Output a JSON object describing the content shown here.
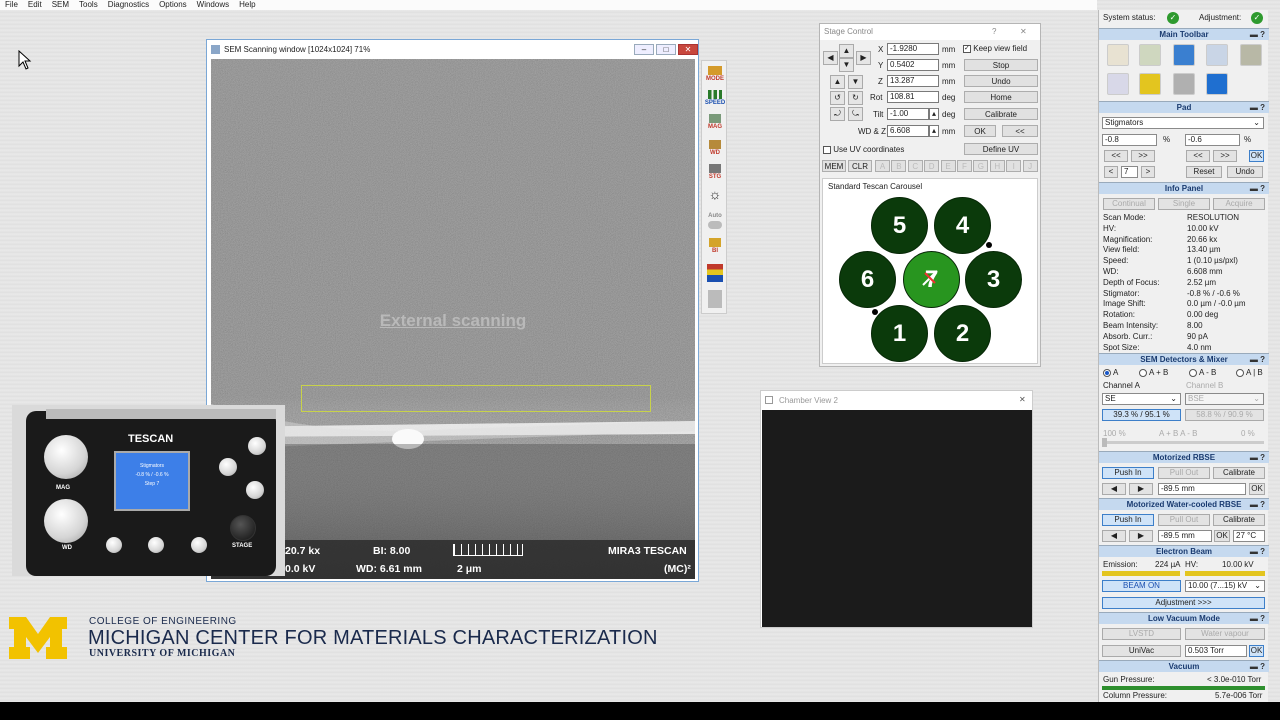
{
  "menu": [
    "File",
    "Edit",
    "SEM",
    "Tools",
    "Diagnostics",
    "Options",
    "Windows",
    "Help"
  ],
  "sem_window": {
    "title": "SEM Scanning window [1024x1024] 71%",
    "overlay_text": "External scanning",
    "info": {
      "mag": "20.7 kx",
      "hv": "0.0 kV",
      "bi": "BI: 8.00",
      "wd": "WD: 6.61 mm",
      "scale": "2 μm",
      "model": "MIRA3 TESCAN",
      "lab": "(MC)²"
    }
  },
  "side_toolbar": [
    "MODE",
    "SPEED",
    "MAG",
    "WD",
    "STG",
    "",
    "Auto",
    "BI",
    "",
    ""
  ],
  "stage": {
    "title": "Stage Control",
    "help": "?",
    "close": "✕",
    "x_label": "X",
    "x_value": "-1.9280",
    "x_unit": "mm",
    "y_label": "Y",
    "y_value": "0.5402",
    "y_unit": "mm",
    "z_label": "Z",
    "z_value": "13.287",
    "z_unit": "mm",
    "rot_label": "Rot",
    "rot_value": "108.81",
    "rot_unit": "deg",
    "tilt_label": "Tilt",
    "tilt_value": "-1.00",
    "tilt_unit": "deg",
    "wdz_label": "WD & Z",
    "wdz_value": "6.608",
    "wdz_unit": "mm",
    "keep_view": "Keep view field",
    "stop": "Stop",
    "undo": "Undo",
    "home": "Home",
    "calibrate": "Calibrate",
    "ok": "OK",
    "back": "<<",
    "uv_label": "Use UV coordinates",
    "define_uv": "Define UV",
    "mem": "MEM",
    "clr": "CLR",
    "positions": [
      "A",
      "B",
      "C",
      "D",
      "E",
      "F",
      "G",
      "H",
      "I",
      "J"
    ],
    "carousel_title": "Standard Tescan Carousel",
    "slots": [
      "5",
      "4",
      "6",
      "7",
      "3",
      "1",
      "2"
    ]
  },
  "chamber": {
    "title": "Chamber View 2",
    "close": "✕"
  },
  "control_panel": {
    "brand": "TESCAN",
    "mag": "MAG",
    "wd": "WD",
    "stage": "STAGE",
    "lcd_title": "Stigmators",
    "lcd_value": "-0.8 % / -0.6 %",
    "lcd_step": "Step 7"
  },
  "logo": {
    "college": "COLLEGE OF ENGINEERING",
    "center": "MICHIGAN CENTER FOR MATERIALS CHARACTERIZATION",
    "university": "UNIVERSITY OF MICHIGAN"
  },
  "right_panel": {
    "system_status": "System status:",
    "adjustment": "Adjustment:",
    "main_toolbar": "Main Toolbar",
    "pad": "Pad",
    "pad_mode": "Stigmators",
    "pad_x": "-0.8",
    "pad_y": "-0.6",
    "pct": "%",
    "ok": "OK",
    "step": "7",
    "reset": "Reset",
    "undo": "Undo",
    "info_panel": "Info Panel",
    "continual": "Continual",
    "single": "Single",
    "acquire": "Acquire",
    "info": [
      [
        "Scan Mode:",
        "RESOLUTION"
      ],
      [
        "HV:",
        "10.00 kV"
      ],
      [
        "Magnification:",
        "20.66 kx"
      ],
      [
        "View field:",
        "13.40 µm"
      ],
      [
        "Speed:",
        "1 (0.10 µs/pxl)"
      ],
      [
        "WD:",
        "6.608 mm"
      ],
      [
        "Depth of Focus:",
        "2.52 µm"
      ],
      [
        "Stigmator:",
        "-0.8 % / -0.6 %"
      ],
      [
        "Image Shift:",
        "0.0 µm / -0.0 µm"
      ],
      [
        "Rotation:",
        "0.00 deg"
      ],
      [
        "Beam Intensity:",
        "8.00"
      ],
      [
        "Absorb. Curr.:",
        "90 pA"
      ],
      [
        "Spot Size:",
        "4.0 nm"
      ]
    ],
    "detectors": "SEM Detectors & Mixer",
    "radio_a": "A",
    "radio_ab": "A + B",
    "radio_amb": "A - B",
    "radio_aorb": "A | B",
    "channel_a": "Channel A",
    "channel_b": "Channel B",
    "det_a": "SE",
    "det_b": "BSE",
    "level_a": "39.3 % / 95.1 %",
    "level_b": "58.8 % / 90.9 %",
    "mix_left": "100 %",
    "mix_mid": "A + B  A - B",
    "mix_right": "0 %",
    "rbse": "Motorized RBSE",
    "push_in": "Push In",
    "pull_out": "Pull Out",
    "calibrate": "Calibrate",
    "rbse_pos": "-89.5 mm",
    "wc_rbse": "Motorized Water-cooled RBSE",
    "wc_pos": "-89.5 mm",
    "wc_temp": "27 °C",
    "electron_beam": "Electron Beam",
    "emission_label": "Emission:",
    "emission_value": "224 µA",
    "hv_label": "HV:",
    "hv_value": "10.00 kV",
    "beam_on": "BEAM ON",
    "hv_select": "10.00 (7...15) kV",
    "adjustment_btn": "Adjustment >>>",
    "lvm": "Low Vacuum Mode",
    "lvstd": "LVSTD",
    "water_vapour": "Water vapour",
    "univac": "UniVac",
    "pressure": "0.503 Torr",
    "vacuum": "Vacuum",
    "gun_label": "Gun Pressure:",
    "gun_value": "< 3.0e-010 Torr",
    "column_label": "Column Pressure:",
    "column_value": "5.7e-006 Torr"
  },
  "colors": {
    "accent_blue": "#3d7fc9",
    "section_header": "#c5d9ef",
    "carousel_green": "#0b3a0b",
    "carousel_active": "#28951f",
    "maize": "#f2c200",
    "michigan_blue": "#1a2a4c"
  }
}
